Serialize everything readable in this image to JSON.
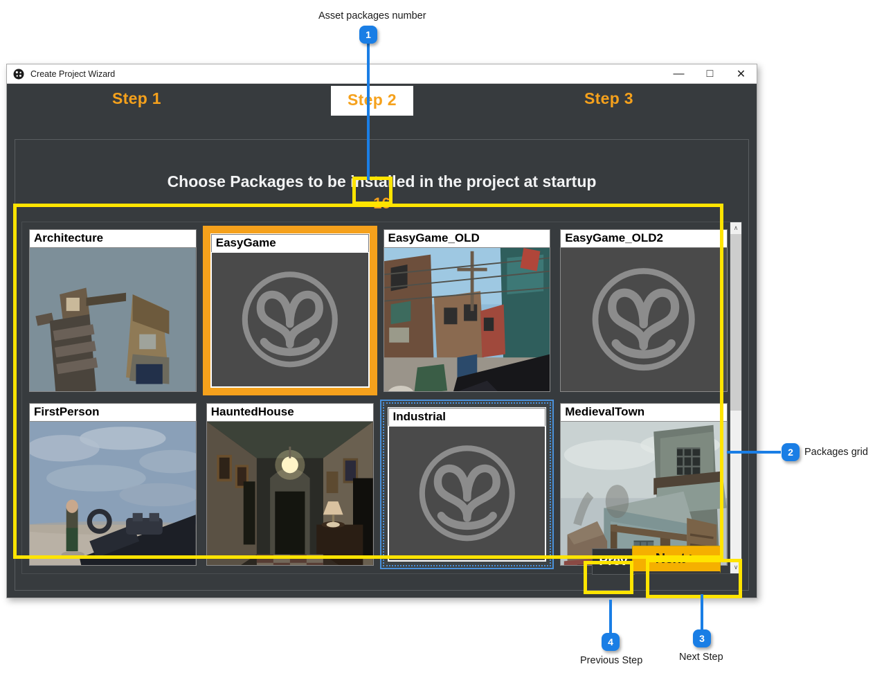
{
  "annotations": {
    "items": [
      {
        "number": "1",
        "label": "Asset packages number"
      },
      {
        "number": "2",
        "label": "Packages grid"
      },
      {
        "number": "3",
        "label": "Next Step"
      },
      {
        "number": "4",
        "label": "Previous Step"
      }
    ],
    "accent_color": "#1a7ee5",
    "highlight_color": "#ffe400"
  },
  "window": {
    "title": "Create Project Wizard",
    "icon": "app-logo-icon",
    "controls": {
      "minimize": "—",
      "maximize": "□",
      "close": "✕"
    }
  },
  "wizard": {
    "steps": [
      {
        "label": "Step 1",
        "active": false
      },
      {
        "label": "Step 2",
        "active": true
      },
      {
        "label": "Step 3",
        "active": false
      }
    ],
    "heading": "Choose Packages to be installed in the project at startup",
    "package_count": "16",
    "buttons": {
      "prev": "Prev",
      "next": "Next >"
    },
    "accent_orange": "#f5a11c",
    "panel_bg": "#373b3e"
  },
  "packages": [
    {
      "name": "Architecture",
      "thumb": "architecture",
      "state": "normal"
    },
    {
      "name": "EasyGame",
      "thumb": "placeholder-logo",
      "state": "selected"
    },
    {
      "name": "EasyGame_OLD",
      "thumb": "street-fps",
      "state": "normal"
    },
    {
      "name": "EasyGame_OLD2",
      "thumb": "placeholder-logo",
      "state": "normal"
    },
    {
      "name": "FirstPerson",
      "thumb": "desert-fps",
      "state": "normal"
    },
    {
      "name": "HauntedHouse",
      "thumb": "hallway",
      "state": "normal"
    },
    {
      "name": "Industrial",
      "thumb": "placeholder-logo",
      "state": "focused"
    },
    {
      "name": "MedievalTown",
      "thumb": "medieval",
      "state": "normal"
    }
  ],
  "scrollbar": {
    "up_arrow": "∧",
    "down_arrow": "∨"
  }
}
